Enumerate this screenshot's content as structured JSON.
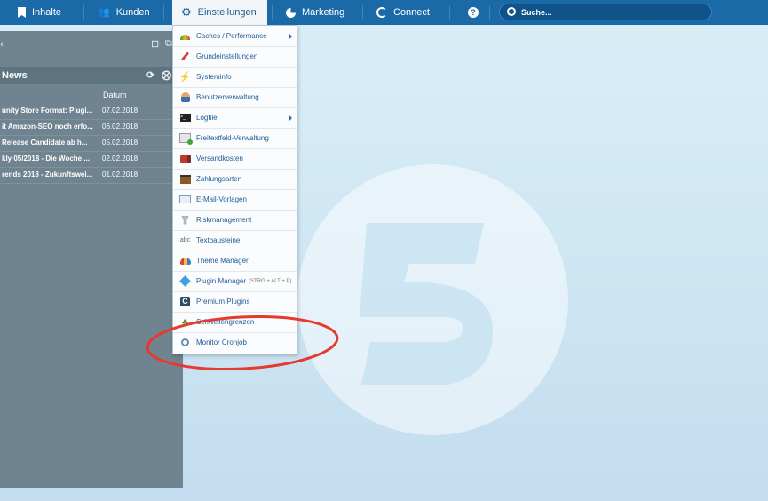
{
  "nav": {
    "items": [
      {
        "label": "Inhalte",
        "icon": "bookmark-icon"
      },
      {
        "label": "Kunden",
        "icon": "users-icon"
      },
      {
        "label": "Einstellungen",
        "icon": "gear-icon"
      },
      {
        "label": "Marketing",
        "icon": "pie-chart-icon"
      },
      {
        "label": "Connect",
        "icon": "connect-icon"
      }
    ],
    "help_icon": "help-icon",
    "search_placeholder": "Suche..."
  },
  "news": {
    "title": "News",
    "date_header": "Datum",
    "rows": [
      {
        "title": "unity Store Format: Plugi...",
        "date": "07.02.2018"
      },
      {
        "title": "it Amazon-SEO noch erfo...",
        "date": "06.02.2018"
      },
      {
        "title": "Release Candidate ab h...",
        "date": "05.02.2018"
      },
      {
        "title": "kly 05/2018 - Die Woche ...",
        "date": "02.02.2018"
      },
      {
        "title": "rends 2018 - Zukunftswei...",
        "date": "01.02.2018"
      }
    ]
  },
  "menu": {
    "items": [
      {
        "label": "Caches / Performance",
        "icon": "speedometer-icon",
        "submenu": true
      },
      {
        "label": "Grundeinstellungen",
        "icon": "wrench-icon"
      },
      {
        "label": "Systeminfo",
        "icon": "lightning-icon"
      },
      {
        "label": "Benutzerverwaltung",
        "icon": "user-icon"
      },
      {
        "label": "Logfile",
        "icon": "terminal-icon",
        "submenu": true
      },
      {
        "label": "Freitextfeld-Verwaltung",
        "icon": "form-add-icon"
      },
      {
        "label": "Versandkosten",
        "icon": "truck-icon"
      },
      {
        "label": "Zahlungsarten",
        "icon": "wallet-icon"
      },
      {
        "label": "E-Mail-Vorlagen",
        "icon": "mail-icon"
      },
      {
        "label": "Riskmanagement",
        "icon": "trophy-icon"
      },
      {
        "label": "Textbausteine",
        "icon": "abc-icon"
      },
      {
        "label": "Theme Manager",
        "icon": "theme-icon"
      },
      {
        "label": "Plugin Manager",
        "shortcut": "(STRG + ALT + P)",
        "icon": "puzzle-icon"
      },
      {
        "label": "Premium Plugins",
        "icon": "premium-icon"
      },
      {
        "label": "Schwellengrenzen",
        "icon": "clover-icon"
      },
      {
        "label": "Monitor Cronjob",
        "icon": "magnifier-icon"
      }
    ]
  }
}
